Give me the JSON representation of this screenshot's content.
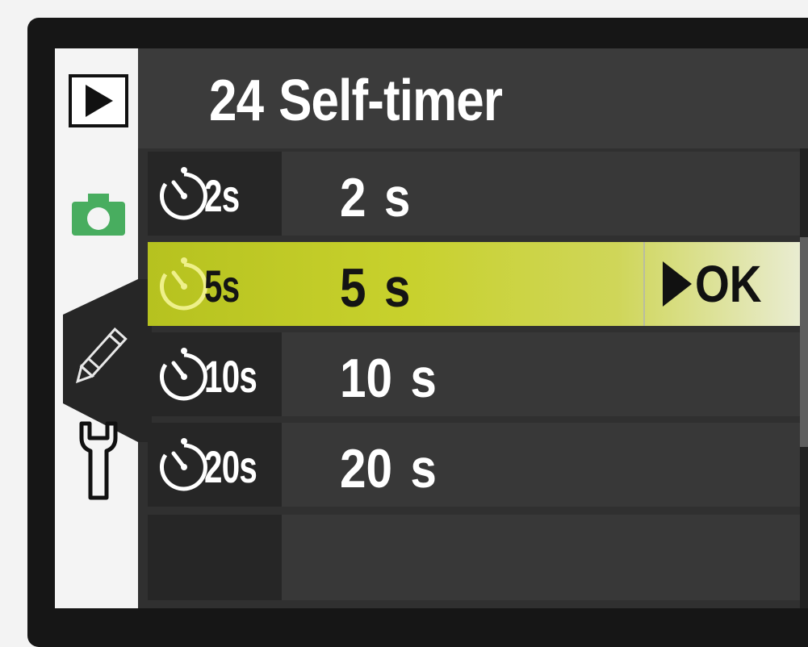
{
  "colors": {
    "highlight": "#c4ce2a",
    "shooting_tab": "#48ad5f",
    "background": "#303030",
    "text": "#ffffff"
  },
  "menu": {
    "number": "24",
    "title": "Self-timer",
    "tabs": [
      {
        "name": "playback",
        "icon": "play-icon"
      },
      {
        "name": "shooting",
        "icon": "camera-icon"
      },
      {
        "name": "custom-settings",
        "icon": "pencil-icon",
        "active": true
      },
      {
        "name": "setup",
        "icon": "wrench-icon"
      }
    ],
    "options": [
      {
        "code": "2s",
        "value": "2",
        "unit": "s",
        "icon": "self-timer-icon"
      },
      {
        "code": "5s",
        "value": "5",
        "unit": "s",
        "icon": "self-timer-icon",
        "selected": true
      },
      {
        "code": "10s",
        "value": "10",
        "unit": "s",
        "icon": "self-timer-icon"
      },
      {
        "code": "20s",
        "value": "20",
        "unit": "s",
        "icon": "self-timer-icon"
      }
    ],
    "confirm_label": "OK"
  }
}
